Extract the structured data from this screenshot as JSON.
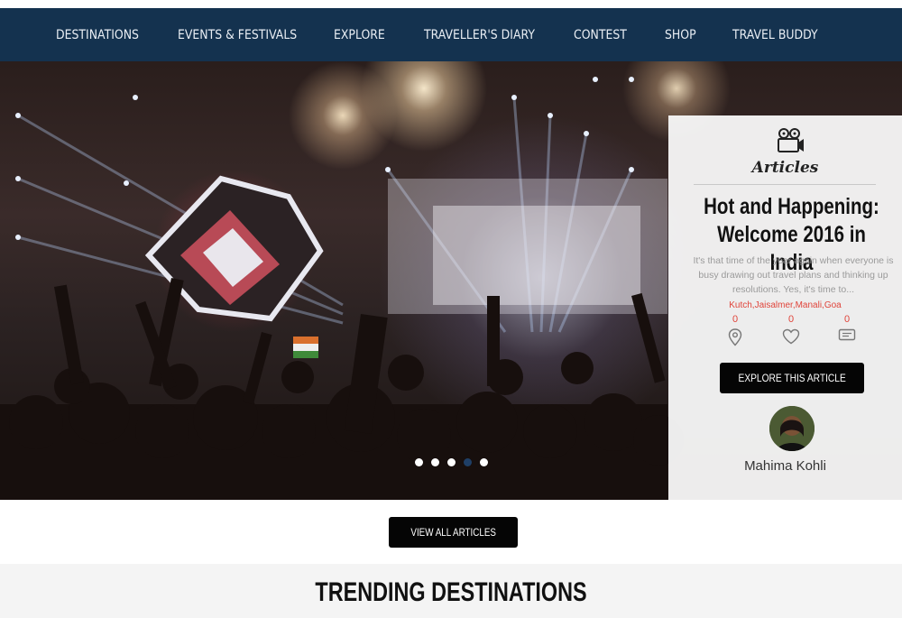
{
  "nav": {
    "items": [
      {
        "label": "DESTINATIONS"
      },
      {
        "label": "EVENTS & FESTIVALS"
      },
      {
        "label": "EXPLORE"
      },
      {
        "label": "TRAVELLER'S DIARY"
      },
      {
        "label": "CONTEST"
      },
      {
        "label": "SHOP"
      },
      {
        "label": "TRAVEL BUDDY"
      }
    ]
  },
  "hero": {
    "image": "concert-crowd-stage-lights",
    "slides": 5,
    "active_slide": 4
  },
  "article": {
    "icon": "camera-icon",
    "tag": "Articles",
    "title_line1": "Hot and Happening:",
    "title_line2": "Welcome 2016 in India",
    "excerpt": "It's that time of the year again when everyone is busy drawing out travel plans and thinking up resolutions. Yes, it's time to...",
    "locations": "Kutch,Jaisalmer,Manali,Goa",
    "stats": [
      {
        "icon": "location-pin-icon",
        "count": "0"
      },
      {
        "icon": "heart-icon",
        "count": "0"
      },
      {
        "icon": "comment-icon",
        "count": "0"
      }
    ],
    "cta_label": "EXPLORE THIS ARTICLE",
    "author": "Mahima Kohli"
  },
  "view_all_label": "VIEW ALL ARTICLES",
  "trending": {
    "title": "TRENDING DESTINATIONS"
  },
  "colors": {
    "nav_bg": "#14324f",
    "accent_red": "#e0443a",
    "button_bg": "#050505",
    "active_dot": "#1f3f66"
  }
}
